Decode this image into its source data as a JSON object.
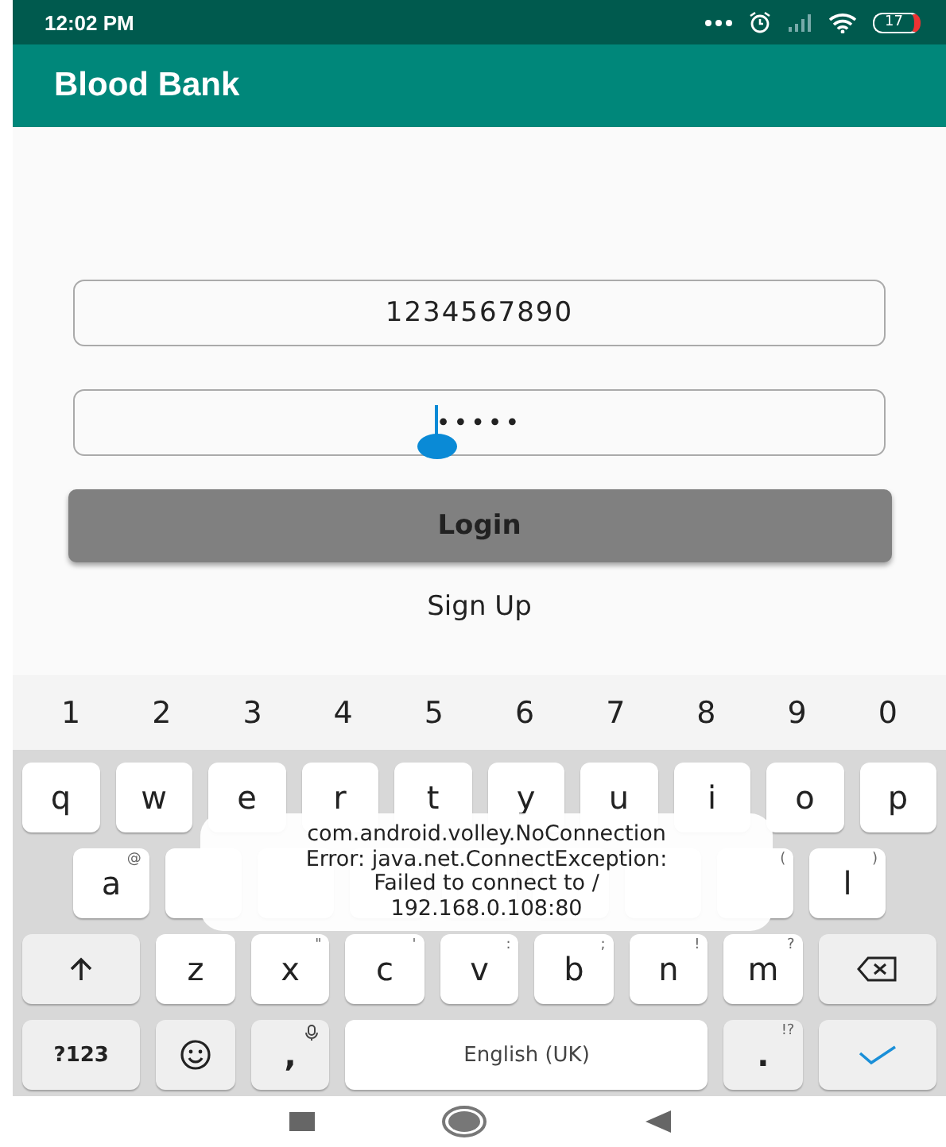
{
  "status_bar": {
    "time": "12:02 PM",
    "battery": "17"
  },
  "app_bar": {
    "title": "Blood Bank"
  },
  "form": {
    "phone_field": {
      "value": "1234567890"
    },
    "password_field": {
      "value": "•••••"
    },
    "login_button": "Login",
    "signup_link": "Sign Up"
  },
  "keyboard": {
    "number_row": [
      "1",
      "2",
      "3",
      "4",
      "5",
      "6",
      "7",
      "8",
      "9",
      "0"
    ],
    "rows": [
      [
        {
          "kind": "letter",
          "label": "q"
        },
        {
          "kind": "letter",
          "label": "w"
        },
        {
          "kind": "letter",
          "label": "e"
        },
        {
          "kind": "letter",
          "label": "r"
        },
        {
          "kind": "letter",
          "label": "t"
        },
        {
          "kind": "letter",
          "label": "y"
        },
        {
          "kind": "letter",
          "label": "u"
        },
        {
          "kind": "letter",
          "label": "i"
        },
        {
          "kind": "letter",
          "label": "o"
        },
        {
          "kind": "letter",
          "label": "p"
        }
      ],
      [
        {
          "kind": "letter",
          "label": "a",
          "hint": "@"
        },
        {
          "kind": "covered"
        },
        {
          "kind": "covered"
        },
        {
          "kind": "covered"
        },
        {
          "kind": "covered"
        },
        {
          "kind": "covered"
        },
        {
          "kind": "covered"
        },
        {
          "kind": "covered",
          "hint": "("
        },
        {
          "kind": "letter",
          "label": "l",
          "hint": ")"
        }
      ],
      [
        {
          "kind": "shift"
        },
        {
          "kind": "letter",
          "label": "z"
        },
        {
          "kind": "letter",
          "label": "x",
          "hint": "\""
        },
        {
          "kind": "letter",
          "label": "c",
          "hint": "'"
        },
        {
          "kind": "letter",
          "label": "v",
          "hint": ":"
        },
        {
          "kind": "letter",
          "label": "b",
          "hint": ";"
        },
        {
          "kind": "letter",
          "label": "n",
          "hint": "!"
        },
        {
          "kind": "letter",
          "label": "m",
          "hint": "?"
        },
        {
          "kind": "backspace"
        }
      ]
    ],
    "bottom_row": [
      {
        "kind": "symbols",
        "label": "?123"
      },
      {
        "kind": "emoji"
      },
      {
        "kind": "comma",
        "label": ","
      },
      {
        "kind": "space",
        "label": "English (UK)"
      },
      {
        "kind": "period",
        "label": ".",
        "hint": "!?"
      },
      {
        "kind": "enter"
      }
    ]
  },
  "toast": {
    "lines": [
      "com.android.volley.NoConnection",
      "Error: java.net.ConnectException:",
      "Failed to connect to /",
      "192.168.0.108:80"
    ]
  }
}
